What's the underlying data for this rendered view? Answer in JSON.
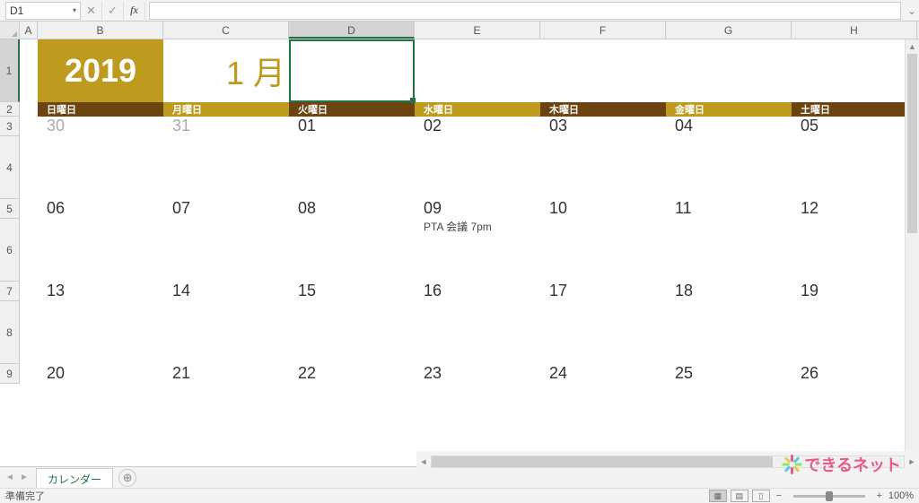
{
  "formula_bar": {
    "name_box": "D1",
    "cancel_label": "✕",
    "confirm_label": "✓",
    "fx_label": "fx",
    "formula_value": "",
    "expand_label": "⌄"
  },
  "columns": [
    "A",
    "B",
    "C",
    "D",
    "E",
    "F",
    "G",
    "H"
  ],
  "selected_column": "D",
  "rows_visible": [
    1,
    2,
    3,
    4,
    5,
    6,
    7,
    8,
    9
  ],
  "selected_row": 1,
  "row_heights": {
    "1": 70,
    "2": 16,
    "3": 22,
    "4": 70,
    "5": 22,
    "6": 70,
    "7": 22,
    "8": 70,
    "9": 22
  },
  "calendar": {
    "year": "2019",
    "month": "1 月",
    "dow": [
      "日曜日",
      "月曜日",
      "火曜日",
      "水曜日",
      "木曜日",
      "金曜日",
      "土曜日"
    ],
    "weeks": [
      {
        "dates": [
          "30",
          "31",
          "01",
          "02",
          "03",
          "04",
          "05"
        ],
        "faded": [
          true,
          true,
          false,
          false,
          false,
          false,
          false
        ],
        "events": [
          "",
          "",
          "",
          "",
          "",
          "",
          ""
        ]
      },
      {
        "dates": [
          "06",
          "07",
          "08",
          "09",
          "10",
          "11",
          "12"
        ],
        "faded": [
          false,
          false,
          false,
          false,
          false,
          false,
          false
        ],
        "events": [
          "",
          "",
          "",
          "PTA 会議 7pm",
          "",
          "",
          ""
        ]
      },
      {
        "dates": [
          "13",
          "14",
          "15",
          "16",
          "17",
          "18",
          "19"
        ],
        "faded": [
          false,
          false,
          false,
          false,
          false,
          false,
          false
        ],
        "events": [
          "",
          "",
          "",
          "",
          "",
          "",
          ""
        ]
      },
      {
        "dates": [
          "20",
          "21",
          "22",
          "23",
          "24",
          "25",
          "26"
        ],
        "faded": [
          false,
          false,
          false,
          false,
          false,
          false,
          false
        ],
        "events": [
          "",
          "",
          "",
          "",
          "",
          "",
          ""
        ]
      }
    ]
  },
  "sheet_tabs": {
    "active": "カレンダー",
    "add_label": "⊕",
    "nav_prev": "◄",
    "nav_next": "►"
  },
  "status_bar": {
    "ready": "準備完了",
    "zoom": "100%",
    "zoom_minus": "−",
    "zoom_plus": "+",
    "view_normal": "▦",
    "view_layout": "▤",
    "view_break": "▯"
  },
  "logo_text": "できるネット"
}
